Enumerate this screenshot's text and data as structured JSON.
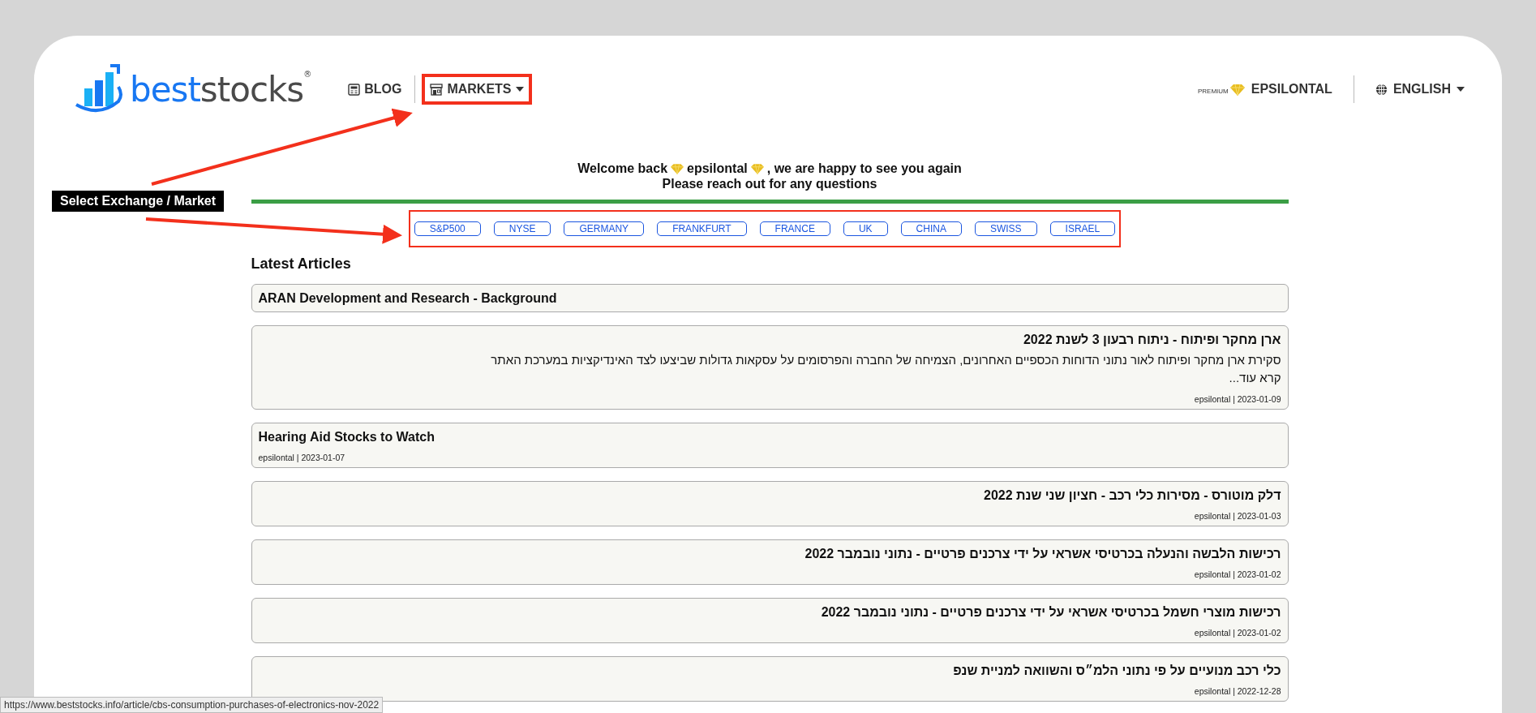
{
  "logo": {
    "text_primary": "best",
    "text_secondary": "stocks",
    "mark": "®"
  },
  "nav": [
    {
      "label": "BLOG",
      "kind": "blog",
      "highlighted": false,
      "dropdown": false
    },
    {
      "label": "MARKETS",
      "kind": "markets",
      "highlighted": true,
      "dropdown": true
    }
  ],
  "account": {
    "tier": "PREMIUM",
    "username": "EPSILONTAL"
  },
  "language": {
    "label": "ENGLISH"
  },
  "welcome": {
    "prefix": "Welcome back",
    "username": "epsilontal",
    "suffix": ", we are happy to see you again",
    "line_2": "Please reach out for any questions"
  },
  "markets": {
    "highlighted": true,
    "items": [
      "S&P500",
      "NYSE",
      "GERMANY",
      "FRANKFURT",
      "FRANCE",
      "UK",
      "CHINA",
      "SWISS",
      "ISRAEL"
    ]
  },
  "annotation": {
    "label": "Select Exchange / Market"
  },
  "latest_articles": {
    "heading": "Latest Articles",
    "articles": [
      {
        "title": "ARAN Development and Research - Background"
      },
      {
        "title": "ארן מחקר ופיתוח - ניתוח רבעון 3 לשנת 2022",
        "excerpt": "סקירת ארן מחקר ופיתוח לאור נתוני הדוחות הכספיים האחרונים, הצמיחה של החברה והפרסומים על עסקאות גדולות שביצעו לצד האינדיקציות במערכת האתר",
        "read_more": "קרא עוד...",
        "meta": "epsilontal | 2023-01-09"
      },
      {
        "title": "Hearing Aid Stocks to Watch",
        "meta": "epsilontal | 2023-01-07"
      },
      {
        "title": "דלק מוטורס - מסירות כלי רכב - חציון שני שנת 2022",
        "meta": "epsilontal | 2023-01-03"
      },
      {
        "title": "רכישות הלבשה והנעלה בכרטיסי אשראי על ידי צרכנים פרטיים - נתוני נובמבר 2022",
        "meta": "epsilontal | 2023-01-02"
      },
      {
        "title": "רכישות מוצרי חשמל בכרטיסי אשראי על ידי צרכנים פרטיים - נתוני נובמבר 2022",
        "meta": "epsilontal | 2023-01-02"
      },
      {
        "title": "כלי רכב מנועיים על פי נתוני הלמ״ס והשוואה למניית שנפ",
        "meta": "epsilontal | 2022-12-28"
      }
    ]
  },
  "status_bar": {
    "url": "https://www.beststocks.info/article/cbs-consumption-purchases-of-electronics-nov-2022"
  }
}
